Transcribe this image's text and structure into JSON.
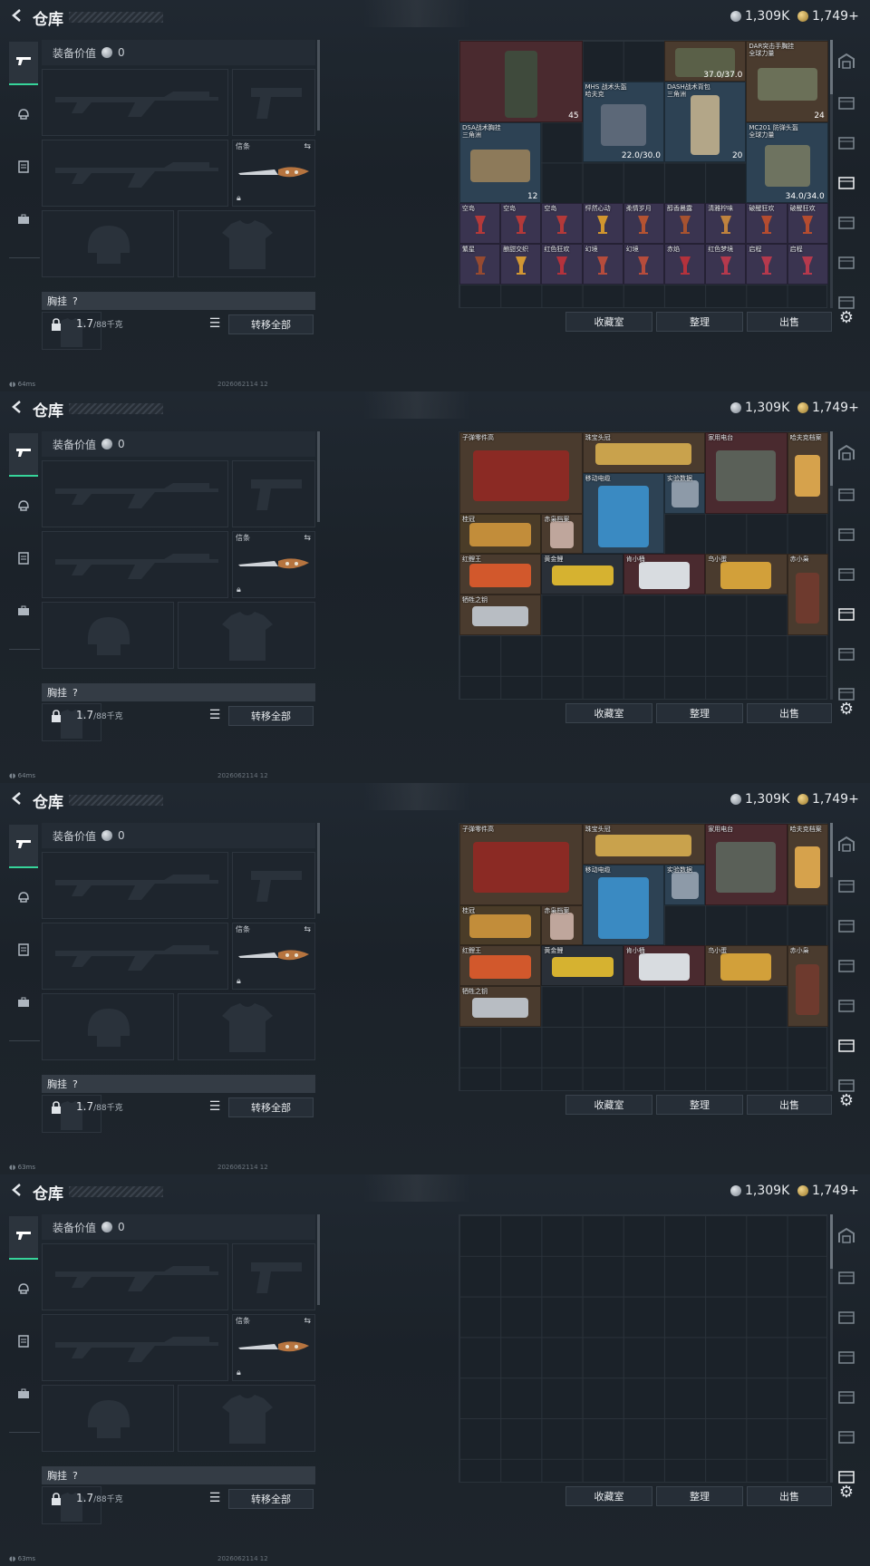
{
  "header": {
    "title": "仓库",
    "currency_silver": "1,309K",
    "currency_gold": "1,749+"
  },
  "equip": {
    "value_label": "装备价值",
    "value": "0",
    "knife_label": "信条",
    "chest_label": "胸挂",
    "chest_hint": "?",
    "weight": "1.7",
    "weight_max": "/88千克",
    "transfer_all": "转移全部"
  },
  "actions": {
    "collection": "收藏室",
    "organize": "整理",
    "sell": "出售"
  },
  "status": [
    {
      "latency": "64ms",
      "stamp": "2026062114 12"
    },
    {
      "latency": "64ms",
      "stamp": "2026062114 12"
    },
    {
      "latency": "63ms",
      "stamp": "2026062114 12"
    },
    {
      "latency": "63ms",
      "stamp": "2026062114 12"
    }
  ],
  "panel1": {
    "items": [
      {
        "name": "",
        "count": "45"
      },
      {
        "name": "37.0/37.0",
        "count": ""
      },
      {
        "name": "DAR突击手胸挂\n全球力量",
        "count": "24"
      },
      {
        "name": "MHS 战术头盔\n哈夫克",
        "count": "22.0/30.0"
      },
      {
        "name": "DASH战术背包\n三角洲",
        "count": "20"
      },
      {
        "name": "DSA战术胸挂\n三角洲",
        "count": "12"
      },
      {
        "name": "MC201 防弹头盔\n全球力量",
        "count": "34.0/34.0"
      }
    ],
    "drinks_row1": [
      "空岛",
      "空岛",
      "空岛",
      "怦然心动",
      "柔情岁月",
      "醇香晨露",
      "清雅柠味",
      "破醒狂欢",
      "破醒狂欢"
    ],
    "drinks_row2": [
      "繁星",
      "酿甜交织",
      "红色狂欢",
      "幻境",
      "幻境",
      "赤焰",
      "红色梦境",
      "启程",
      "启程"
    ]
  },
  "panel2": {
    "items": [
      "子弹零件高",
      "珠宝头冠",
      "家用电台",
      "哈夫克档案",
      "移动电缆",
      "实验数据",
      "桂冠",
      "赤枭档案",
      "红鲤王",
      "黄金鲤",
      "肯小桶",
      "鸟小蛋",
      "赤小枭",
      "牺牲之钥"
    ]
  }
}
